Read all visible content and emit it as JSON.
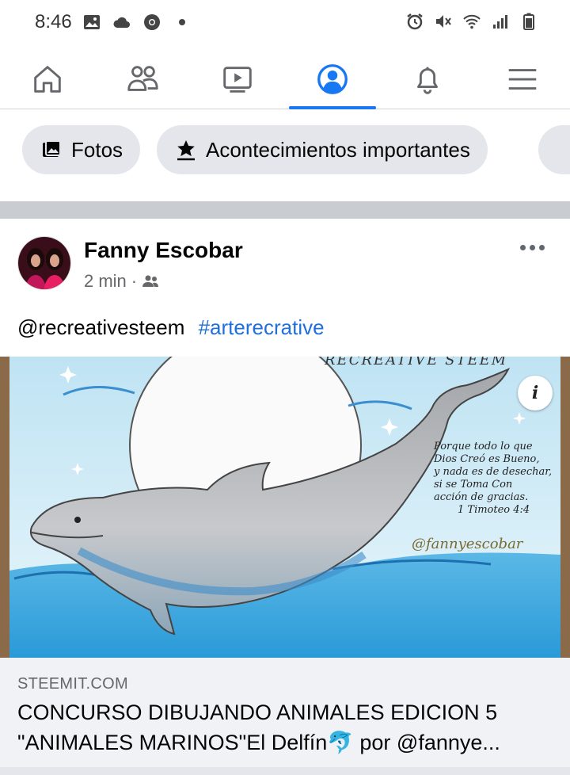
{
  "status_bar": {
    "time": "8:46"
  },
  "nav": {
    "tabs": [
      {
        "name": "home-icon",
        "active": false
      },
      {
        "name": "friends-icon",
        "active": false
      },
      {
        "name": "watch-icon",
        "active": false
      },
      {
        "name": "profile-icon",
        "active": true
      },
      {
        "name": "bell-icon",
        "active": false
      },
      {
        "name": "menu-icon",
        "active": false
      }
    ],
    "accent": "#1877f2"
  },
  "chips": [
    {
      "label": "Fotos",
      "icon": "photos-icon"
    },
    {
      "label": "Acontecimientos importantes",
      "icon": "life-event-icon"
    }
  ],
  "post": {
    "author": "Fanny Escobar",
    "time": "2 min",
    "separator": "·",
    "audience_icon": "friends-audience-icon",
    "mention": "@recreativesteem",
    "hashtag": "#arterecrative",
    "image": {
      "header_text": "RECREATIVE STEEM",
      "poem_lines": [
        "Porque todo lo que",
        "Dios Creó es Bueno,",
        "y nada es de desechar,",
        "si se Toma Con",
        "acción de gracias.",
        "1 Timoteo 4:4"
      ],
      "signature": "@fannyescobar",
      "info_label": "i"
    },
    "link": {
      "domain": "STEEMIT.COM",
      "title": "CONCURSO DIBUJANDO ANIMALES EDICION 5 \"ANIMALES MARINOS\"El Delfín🐬 por @fannye..."
    }
  },
  "colors": {
    "link_blue": "#216fdb",
    "chip_bg": "#e4e6eb",
    "secondary_text": "#65676b"
  }
}
